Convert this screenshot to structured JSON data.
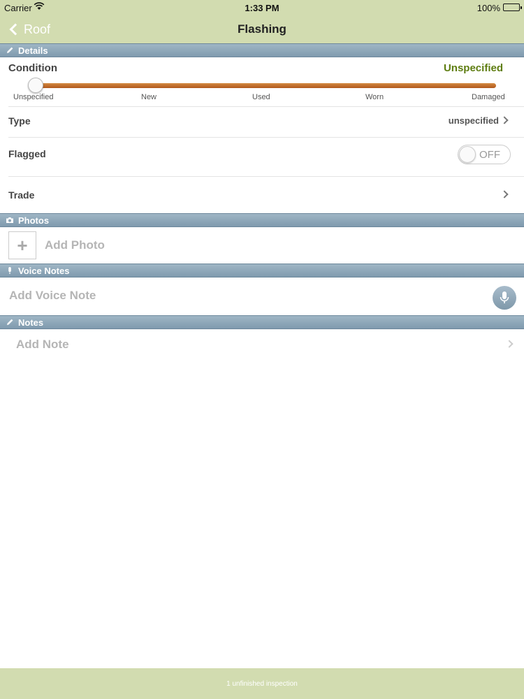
{
  "status_bar": {
    "carrier": "Carrier",
    "time": "1:33 PM",
    "battery": "100%"
  },
  "nav": {
    "back_label": "Roof",
    "title": "Flashing"
  },
  "sections": {
    "details": "Details",
    "photos": "Photos",
    "voice_notes": "Voice Notes",
    "notes": "Notes"
  },
  "condition": {
    "label": "Condition",
    "value": "Unspecified",
    "ticks": [
      "Unspecified",
      "New",
      "Used",
      "Worn",
      "Damaged"
    ],
    "slider_position": 0
  },
  "type": {
    "label": "Type",
    "value": "unspecified"
  },
  "flagged": {
    "label": "Flagged",
    "toggle_label": "OFF",
    "on": false
  },
  "trade": {
    "label": "Trade"
  },
  "photos": {
    "add_label": "Add Photo",
    "add_icon": "+"
  },
  "voice": {
    "add_label": "Add Voice Note"
  },
  "notes": {
    "add_label": "Add Note"
  },
  "footer": {
    "text": "1 unfinished inspection"
  },
  "colors": {
    "bar": "#d2dcb0",
    "section_header": "#8aa3b6",
    "accent_value": "#5e7d11",
    "slider": "#c06a2b"
  }
}
